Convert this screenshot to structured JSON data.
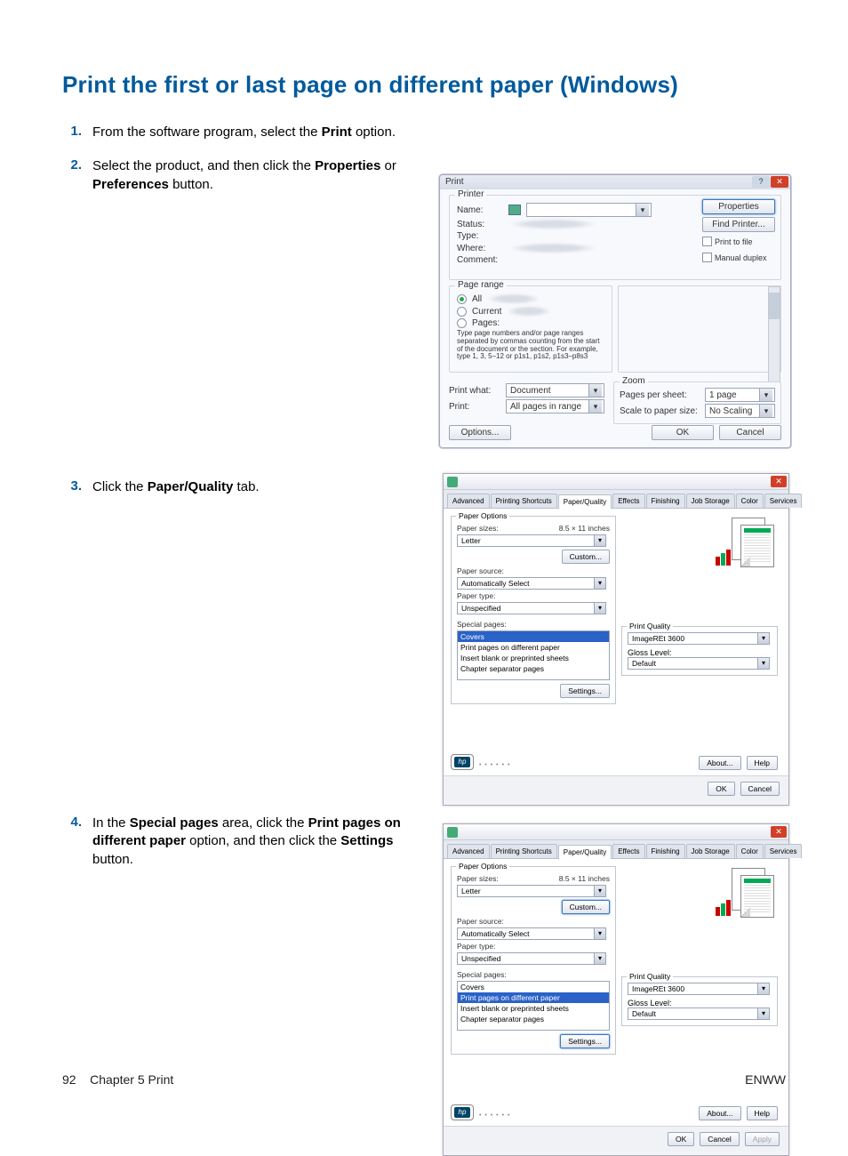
{
  "page_title": "Print the first or last page on different paper (Windows)",
  "steps": [
    {
      "num": "1.",
      "html": "From the software program, select the <b>Print</b> option."
    },
    {
      "num": "2.",
      "html": "Select the product, and then click the <b>Properties</b> or <b>Preferences</b> button."
    },
    {
      "num": "3.",
      "html": "Click the <b>Paper/Quality</b> tab."
    },
    {
      "num": "4.",
      "html": "In the <b>Special pages</b> area, click the <b>Print pages on different paper</b> option, and then click the <b>Settings</b> button."
    }
  ],
  "footer": {
    "page_number": "92",
    "chapter": "Chapter 5   Print",
    "brand": "ENWW"
  },
  "print_dialog": {
    "title": "Print",
    "printer_group": "Printer",
    "name_label": "Name:",
    "status_label": "Status:",
    "type_label": "Type:",
    "where_label": "Where:",
    "comment_label": "Comment:",
    "properties_btn": "Properties",
    "find_printer_btn": "Find Printer...",
    "print_to_file": "Print to file",
    "manual_duplex": "Manual duplex",
    "page_range_group": "Page range",
    "all_radio": "All",
    "current_radio": "Current",
    "pages_radio": "Pages:",
    "range_hint": "Type page numbers and/or page ranges separated by commas counting from the start of the document or the section. For example, type 1, 3, 5–12 or p1s1, p1s2, p1s3–p8s3",
    "print_what_label": "Print what:",
    "print_what_value": "Document",
    "print_label": "Print:",
    "print_value": "All pages in range",
    "zoom_group": "Zoom",
    "pps_label": "Pages per sheet:",
    "pps_value": "1 page",
    "scale_label": "Scale to paper size:",
    "scale_value": "No Scaling",
    "options_btn": "Options...",
    "ok_btn": "OK",
    "cancel_btn": "Cancel"
  },
  "props_dialog": {
    "tabs": [
      "Advanced",
      "Printing Shortcuts",
      "Paper/Quality",
      "Effects",
      "Finishing",
      "Job Storage",
      "Color",
      "Services"
    ],
    "active_tab": "Paper/Quality",
    "paper_options_group": "Paper Options",
    "paper_sizes_label": "Paper sizes:",
    "paper_sizes_dim": "8.5 × 11 inches",
    "paper_sizes_value": "Letter",
    "custom_btn": "Custom...",
    "paper_source_label": "Paper source:",
    "paper_source_value": "Automatically Select",
    "paper_type_label": "Paper type:",
    "paper_type_value": "Unspecified",
    "special_pages_label": "Special pages:",
    "special_list": [
      "Covers",
      "Print pages on different paper",
      "Insert blank or preprinted sheets",
      "Chapter separator pages"
    ],
    "settings_btn": "Settings...",
    "print_quality_group": "Print Quality",
    "pq_value": "ImageREt 3600",
    "gloss_label": "Gloss Level:",
    "gloss_value": "Default",
    "about_btn": "About...",
    "help_btn": "Help",
    "ok_btn": "OK",
    "cancel_btn": "Cancel",
    "apply_btn": "Apply",
    "hp_logo_text": "hp"
  }
}
